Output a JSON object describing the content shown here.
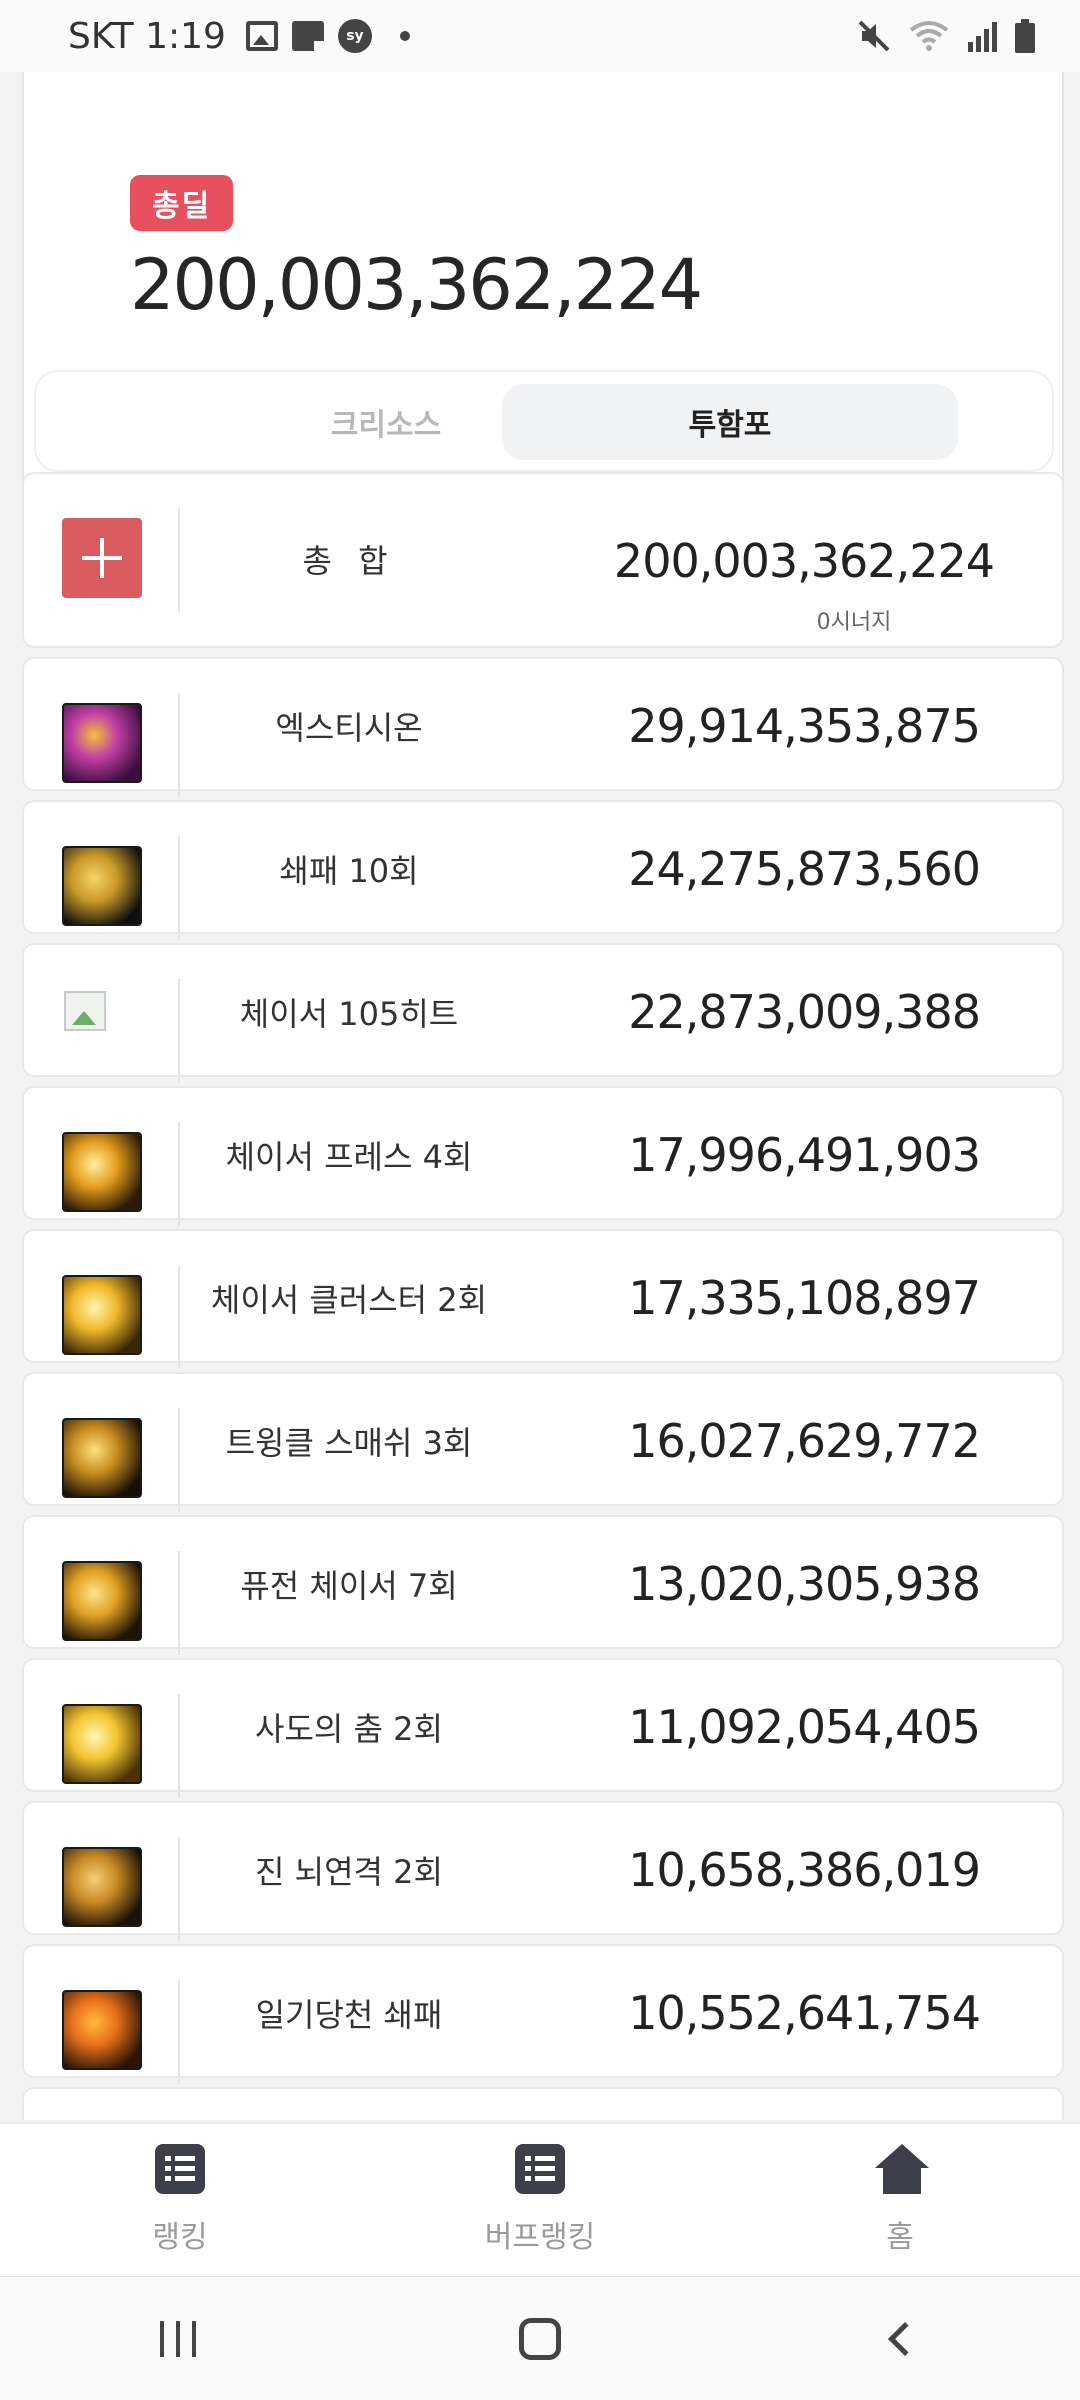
{
  "status_bar": {
    "time": "SKT 1:19",
    "left_icons": [
      "gallery-icon",
      "note-icon",
      "sy-icon",
      "dot-icon"
    ],
    "sy_text": "sy",
    "right_icons": [
      "mute-icon",
      "wifi-icon",
      "signal-icon",
      "battery-icon"
    ]
  },
  "summary": {
    "badge": "총딜",
    "total": "200,003,362,224"
  },
  "tabs": [
    {
      "label": "크리소스",
      "active": false
    },
    {
      "label": "투함포",
      "active": true
    }
  ],
  "total_row": {
    "name": "총 합",
    "value": "200,003,362,224",
    "synergy": "0시너지"
  },
  "skills": [
    {
      "name": "엑스티시온",
      "value": "29,914,353,875",
      "icon": "extinction-icon",
      "colors": [
        "#3a0f3d",
        "#c23fa6",
        "#f2c23a"
      ]
    },
    {
      "name": "쇄패 10회",
      "value": "24,275,873,560",
      "icon": "bat-icon",
      "colors": [
        "#101010",
        "#c99a2a",
        "#f7d36a"
      ]
    },
    {
      "name": "체이서 105히트",
      "value": "22,873,009,388",
      "icon": "broken-image-icon",
      "colors": []
    },
    {
      "name": "체이서 프레스 4회",
      "value": "17,996,491,903",
      "icon": "chaser-press-icon",
      "colors": [
        "#2a1a08",
        "#e59d1d",
        "#fff1a0"
      ]
    },
    {
      "name": "체이서 클러스터 2회",
      "value": "17,335,108,897",
      "icon": "chaser-cluster-icon",
      "colors": [
        "#3a2608",
        "#f0b82a",
        "#fff6b0"
      ]
    },
    {
      "name": "트윙클 스매쉬 3회",
      "value": "16,027,629,772",
      "icon": "twinkle-smash-icon",
      "colors": [
        "#181008",
        "#c88d1f",
        "#ffe080"
      ]
    },
    {
      "name": "퓨전 체이서 7회",
      "value": "13,020,305,938",
      "icon": "fusion-chaser-icon",
      "colors": [
        "#1e1406",
        "#e0a023",
        "#ffe58a"
      ]
    },
    {
      "name": "사도의 춤 2회",
      "value": "11,092,054,405",
      "icon": "apostle-dance-icon",
      "colors": [
        "#4a3206",
        "#f3c531",
        "#fff7b5"
      ]
    },
    {
      "name": "진 뇌연격 2회",
      "value": "10,658,386,019",
      "icon": "thunder-strike-icon",
      "colors": [
        "#1a1208",
        "#c98a25",
        "#f5cf7a"
      ]
    },
    {
      "name": "일기당천 쇄패",
      "value": "10,552,641,754",
      "icon": "ilgidangcheon-icon",
      "colors": [
        "#2a1606",
        "#e8701c",
        "#ffbb3a"
      ]
    }
  ],
  "bottom_nav": [
    {
      "label": "랭킹",
      "icon": "list-icon"
    },
    {
      "label": "버프랭킹",
      "icon": "list-icon"
    },
    {
      "label": "홈",
      "icon": "home-icon"
    }
  ],
  "system_nav": [
    "recents-button",
    "home-button",
    "back-button"
  ]
}
